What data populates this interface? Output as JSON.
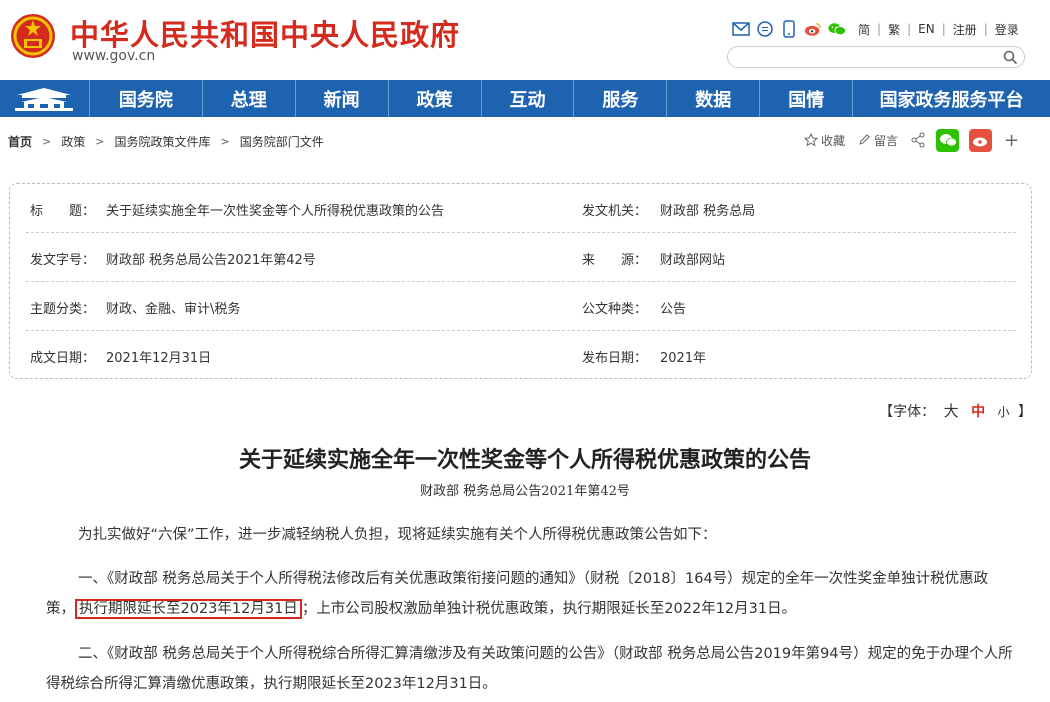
{
  "site": {
    "title": "中华人民共和国中央人民政府",
    "url": "www.gov.cn"
  },
  "top_links": {
    "lang_simplified": "简",
    "lang_traditional": "繁",
    "lang_english": "EN",
    "register": "注册",
    "login": "登录",
    "separator": "|"
  },
  "search": {
    "placeholder": ""
  },
  "nav": {
    "items": [
      {
        "label": "国务院"
      },
      {
        "label": "总理"
      },
      {
        "label": "新闻"
      },
      {
        "label": "政策"
      },
      {
        "label": "互动"
      },
      {
        "label": "服务"
      },
      {
        "label": "数据"
      },
      {
        "label": "国情"
      },
      {
        "label": "国家政务服务平台"
      }
    ]
  },
  "breadcrumb": {
    "items": [
      "首页",
      "政策",
      "国务院政策文件库",
      "国务院部门文件"
    ],
    "arrow": ">"
  },
  "tools": {
    "collect": "收藏",
    "comment": "留言",
    "plus": "+"
  },
  "info": {
    "title_label": "标　　题：",
    "title_value": "关于延续实施全年一次性奖金等个人所得税优惠政策的公告",
    "issuer_label": "发文机关：",
    "issuer_value": "财政部  税务总局",
    "docno_label": "发文字号：",
    "docno_value": "财政部  税务总局公告2021年第42号",
    "source_label": "来　　源：",
    "source_value": "财政部网站",
    "topic_label": "主题分类：",
    "topic_value": "财政、金融、审计\\税务",
    "type_label": "公文种类：",
    "type_value": "公告",
    "created_label": "成文日期：",
    "created_value": "2021年12月31日",
    "published_label": "发布日期：",
    "published_value": "2021年"
  },
  "font_ctrl": {
    "prefix": "【字体：",
    "large": "大",
    "medium": "中",
    "small": "小",
    "suffix": "】"
  },
  "article": {
    "title": "关于延续实施全年一次性奖金等个人所得税优惠政策的公告",
    "subtitle": "财政部  税务总局公告2021年第42号",
    "p1": "为扎实做好“六保”工作，进一步减轻纳税人负担，现将延续实施有关个人所得税优惠政策公告如下：",
    "p2_a": "一、《财政部  税务总局关于个人所得税法修改后有关优惠政策衔接问题的通知》（财税〔2018〕164号）规定的全年一次性奖金单独计税优惠政策，",
    "p2_hl": "执行期限延长至2023年12月31日",
    "p2_b": "；上市公司股权激励单独计税优惠政策，执行期限延长至2022年12月31日。",
    "p3": "二、《财政部  税务总局关于个人所得税综合所得汇算清缴涉及有关政策问题的公告》（财政部  税务总局公告2019年第94号）规定的免于办理个人所得税综合所得汇算清缴优惠政策，执行期限延长至2023年12月31日。"
  },
  "colors": {
    "brand_red": "#d52b1e",
    "nav_blue": "#1e63b0",
    "wechat_green": "#2dc100",
    "weibo_red": "#e6503f"
  }
}
